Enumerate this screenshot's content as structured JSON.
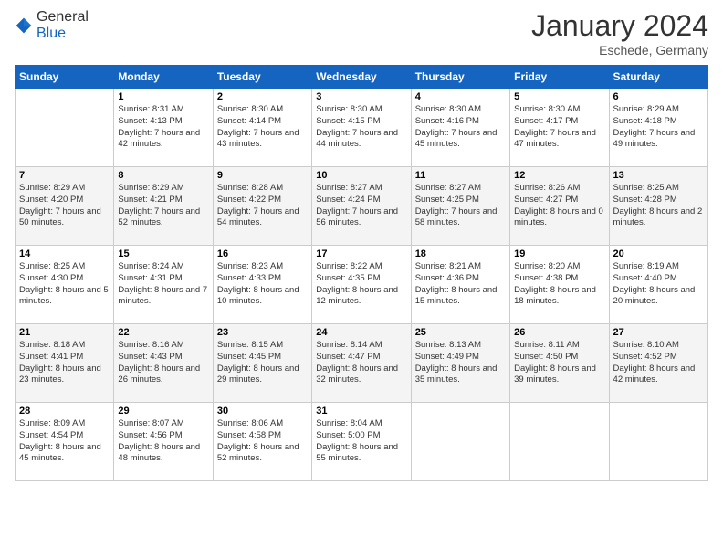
{
  "header": {
    "logo_general": "General",
    "logo_blue": "Blue",
    "month_title": "January 2024",
    "subtitle": "Eschede, Germany"
  },
  "weekdays": [
    "Sunday",
    "Monday",
    "Tuesday",
    "Wednesday",
    "Thursday",
    "Friday",
    "Saturday"
  ],
  "weeks": [
    [
      {
        "day": "",
        "sunrise": "",
        "sunset": "",
        "daylight": ""
      },
      {
        "day": "1",
        "sunrise": "Sunrise: 8:31 AM",
        "sunset": "Sunset: 4:13 PM",
        "daylight": "Daylight: 7 hours and 42 minutes."
      },
      {
        "day": "2",
        "sunrise": "Sunrise: 8:30 AM",
        "sunset": "Sunset: 4:14 PM",
        "daylight": "Daylight: 7 hours and 43 minutes."
      },
      {
        "day": "3",
        "sunrise": "Sunrise: 8:30 AM",
        "sunset": "Sunset: 4:15 PM",
        "daylight": "Daylight: 7 hours and 44 minutes."
      },
      {
        "day": "4",
        "sunrise": "Sunrise: 8:30 AM",
        "sunset": "Sunset: 4:16 PM",
        "daylight": "Daylight: 7 hours and 45 minutes."
      },
      {
        "day": "5",
        "sunrise": "Sunrise: 8:30 AM",
        "sunset": "Sunset: 4:17 PM",
        "daylight": "Daylight: 7 hours and 47 minutes."
      },
      {
        "day": "6",
        "sunrise": "Sunrise: 8:29 AM",
        "sunset": "Sunset: 4:18 PM",
        "daylight": "Daylight: 7 hours and 49 minutes."
      }
    ],
    [
      {
        "day": "7",
        "sunrise": "Sunrise: 8:29 AM",
        "sunset": "Sunset: 4:20 PM",
        "daylight": "Daylight: 7 hours and 50 minutes."
      },
      {
        "day": "8",
        "sunrise": "Sunrise: 8:29 AM",
        "sunset": "Sunset: 4:21 PM",
        "daylight": "Daylight: 7 hours and 52 minutes."
      },
      {
        "day": "9",
        "sunrise": "Sunrise: 8:28 AM",
        "sunset": "Sunset: 4:22 PM",
        "daylight": "Daylight: 7 hours and 54 minutes."
      },
      {
        "day": "10",
        "sunrise": "Sunrise: 8:27 AM",
        "sunset": "Sunset: 4:24 PM",
        "daylight": "Daylight: 7 hours and 56 minutes."
      },
      {
        "day": "11",
        "sunrise": "Sunrise: 8:27 AM",
        "sunset": "Sunset: 4:25 PM",
        "daylight": "Daylight: 7 hours and 58 minutes."
      },
      {
        "day": "12",
        "sunrise": "Sunrise: 8:26 AM",
        "sunset": "Sunset: 4:27 PM",
        "daylight": "Daylight: 8 hours and 0 minutes."
      },
      {
        "day": "13",
        "sunrise": "Sunrise: 8:25 AM",
        "sunset": "Sunset: 4:28 PM",
        "daylight": "Daylight: 8 hours and 2 minutes."
      }
    ],
    [
      {
        "day": "14",
        "sunrise": "Sunrise: 8:25 AM",
        "sunset": "Sunset: 4:30 PM",
        "daylight": "Daylight: 8 hours and 5 minutes."
      },
      {
        "day": "15",
        "sunrise": "Sunrise: 8:24 AM",
        "sunset": "Sunset: 4:31 PM",
        "daylight": "Daylight: 8 hours and 7 minutes."
      },
      {
        "day": "16",
        "sunrise": "Sunrise: 8:23 AM",
        "sunset": "Sunset: 4:33 PM",
        "daylight": "Daylight: 8 hours and 10 minutes."
      },
      {
        "day": "17",
        "sunrise": "Sunrise: 8:22 AM",
        "sunset": "Sunset: 4:35 PM",
        "daylight": "Daylight: 8 hours and 12 minutes."
      },
      {
        "day": "18",
        "sunrise": "Sunrise: 8:21 AM",
        "sunset": "Sunset: 4:36 PM",
        "daylight": "Daylight: 8 hours and 15 minutes."
      },
      {
        "day": "19",
        "sunrise": "Sunrise: 8:20 AM",
        "sunset": "Sunset: 4:38 PM",
        "daylight": "Daylight: 8 hours and 18 minutes."
      },
      {
        "day": "20",
        "sunrise": "Sunrise: 8:19 AM",
        "sunset": "Sunset: 4:40 PM",
        "daylight": "Daylight: 8 hours and 20 minutes."
      }
    ],
    [
      {
        "day": "21",
        "sunrise": "Sunrise: 8:18 AM",
        "sunset": "Sunset: 4:41 PM",
        "daylight": "Daylight: 8 hours and 23 minutes."
      },
      {
        "day": "22",
        "sunrise": "Sunrise: 8:16 AM",
        "sunset": "Sunset: 4:43 PM",
        "daylight": "Daylight: 8 hours and 26 minutes."
      },
      {
        "day": "23",
        "sunrise": "Sunrise: 8:15 AM",
        "sunset": "Sunset: 4:45 PM",
        "daylight": "Daylight: 8 hours and 29 minutes."
      },
      {
        "day": "24",
        "sunrise": "Sunrise: 8:14 AM",
        "sunset": "Sunset: 4:47 PM",
        "daylight": "Daylight: 8 hours and 32 minutes."
      },
      {
        "day": "25",
        "sunrise": "Sunrise: 8:13 AM",
        "sunset": "Sunset: 4:49 PM",
        "daylight": "Daylight: 8 hours and 35 minutes."
      },
      {
        "day": "26",
        "sunrise": "Sunrise: 8:11 AM",
        "sunset": "Sunset: 4:50 PM",
        "daylight": "Daylight: 8 hours and 39 minutes."
      },
      {
        "day": "27",
        "sunrise": "Sunrise: 8:10 AM",
        "sunset": "Sunset: 4:52 PM",
        "daylight": "Daylight: 8 hours and 42 minutes."
      }
    ],
    [
      {
        "day": "28",
        "sunrise": "Sunrise: 8:09 AM",
        "sunset": "Sunset: 4:54 PM",
        "daylight": "Daylight: 8 hours and 45 minutes."
      },
      {
        "day": "29",
        "sunrise": "Sunrise: 8:07 AM",
        "sunset": "Sunset: 4:56 PM",
        "daylight": "Daylight: 8 hours and 48 minutes."
      },
      {
        "day": "30",
        "sunrise": "Sunrise: 8:06 AM",
        "sunset": "Sunset: 4:58 PM",
        "daylight": "Daylight: 8 hours and 52 minutes."
      },
      {
        "day": "31",
        "sunrise": "Sunrise: 8:04 AM",
        "sunset": "Sunset: 5:00 PM",
        "daylight": "Daylight: 8 hours and 55 minutes."
      },
      {
        "day": "",
        "sunrise": "",
        "sunset": "",
        "daylight": ""
      },
      {
        "day": "",
        "sunrise": "",
        "sunset": "",
        "daylight": ""
      },
      {
        "day": "",
        "sunrise": "",
        "sunset": "",
        "daylight": ""
      }
    ]
  ]
}
